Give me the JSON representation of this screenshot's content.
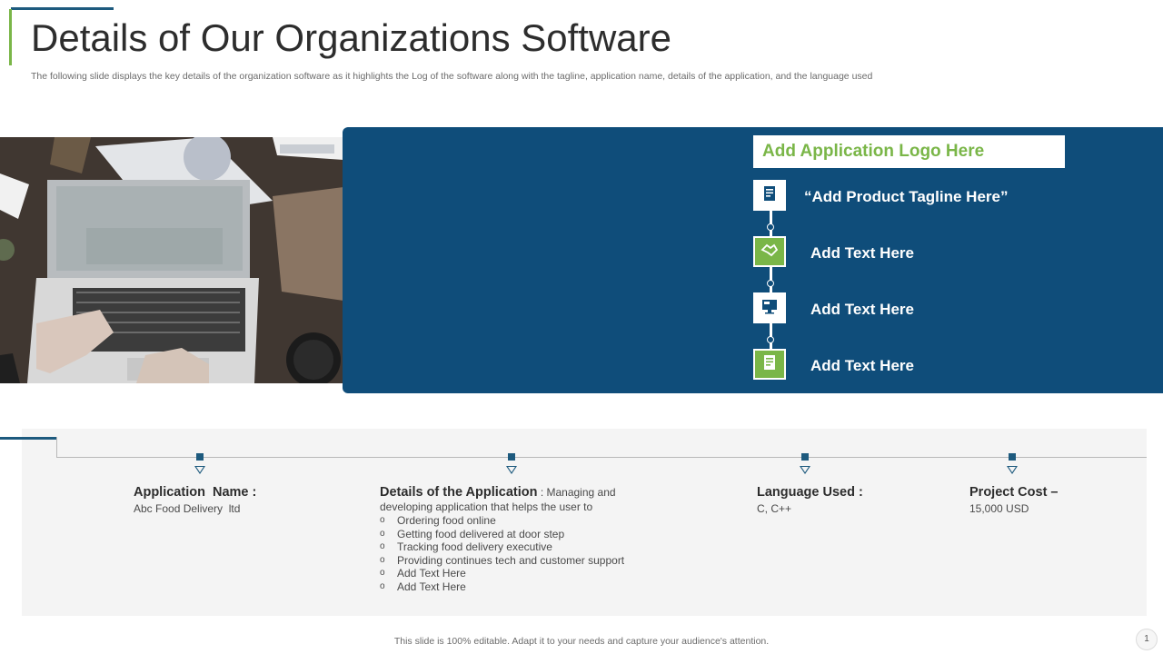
{
  "header": {
    "title": "Details of Our Organizations Software",
    "subtitle": "The following slide displays the key details of the organization software as it highlights the Log of the software along with the tagline, application name, details of the application, and the language used"
  },
  "panel": {
    "logo_text": "Add Application Logo Here",
    "items": [
      {
        "label": "“Add Product Tagline Here”",
        "icon": "document-icon",
        "style": "white"
      },
      {
        "label": "Add Text Here",
        "icon": "handshake-icon",
        "style": "green"
      },
      {
        "label": "Add Text Here",
        "icon": "monitor-icon",
        "style": "white"
      },
      {
        "label": "Add Text Here",
        "icon": "document-icon",
        "style": "green"
      }
    ]
  },
  "details": {
    "app_name_title": "Application  Name :",
    "app_name_value": "Abc Food Delivery  ltd",
    "details_title": "Details of the Application",
    "details_intro": " : Managing and developing application that helps the user to",
    "details_bullets": [
      "Ordering food online",
      "Getting food delivered at door step",
      "Tracking food delivery executive",
      "Providing continues tech and customer support",
      "Add Text Here",
      "Add Text Here"
    ],
    "language_title": "Language Used :",
    "language_value": "C, C++",
    "cost_title": "Project Cost –",
    "cost_value": "15,000 USD"
  },
  "footer": {
    "note": "This slide is 100% editable.  Adapt it to your needs and capture your audience's attention.",
    "page_number": "1"
  },
  "colors": {
    "panel_blue": "#0f4d7a",
    "accent_green": "#7ab648",
    "accent_navy": "#1d5a7e"
  }
}
